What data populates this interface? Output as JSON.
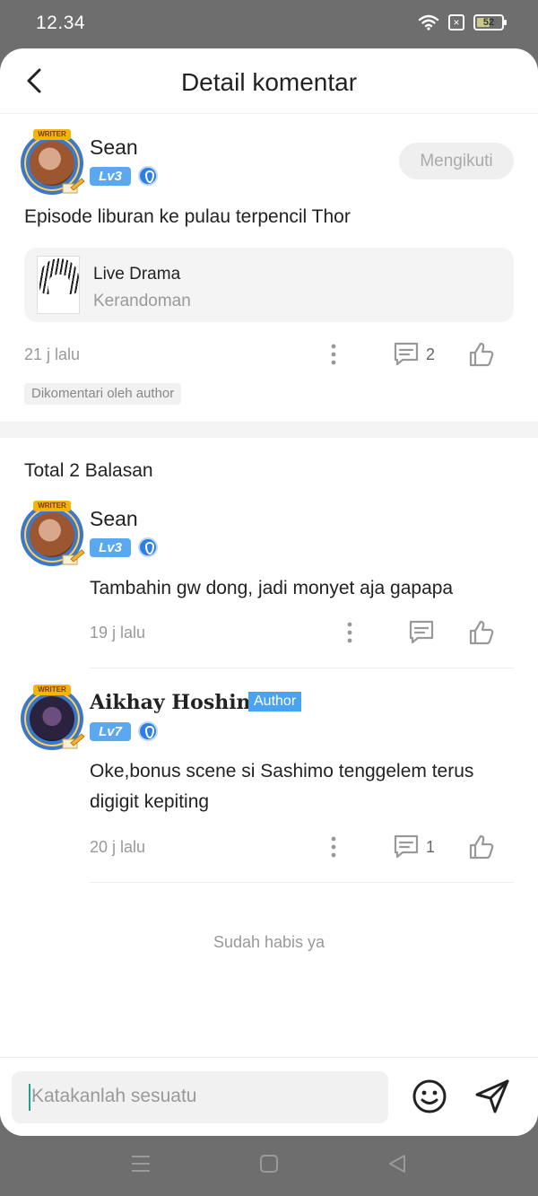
{
  "status_bar": {
    "time": "12.34",
    "battery": "52",
    "battery_level": 0.52
  },
  "header": {
    "title": "Detail komentar"
  },
  "post": {
    "user": "Sean",
    "level": "Lv3",
    "avatar_badge": "WRITER",
    "follow_label": "Mengikuti",
    "text": "Episode liburan ke pulau terpencil Thor",
    "book": {
      "title": "Live Drama",
      "subtitle": "Kerandoman"
    },
    "time": "21 j lalu",
    "reply_count": "2",
    "tag": "Dikomentari oleh author"
  },
  "replies_header": "Total 2 Balasan",
  "replies": [
    {
      "user": "Sean",
      "level": "Lv3",
      "avatar_badge": "WRITER",
      "text": "Tambahin gw dong, jadi monyet aja gapapa",
      "time": "19 j lalu",
      "reply_count": ""
    },
    {
      "user": "Aikhay Hoshino",
      "author_tag": "Author",
      "level": "Lv7",
      "avatar_badge": "WRITER",
      "text": "Oke,bonus scene si Sashimo tenggelem terus digigit kepiting",
      "time": "20 j lalu",
      "reply_count": "1"
    }
  ],
  "end_text": "Sudah habis ya",
  "composer": {
    "placeholder": "Katakanlah sesuatu"
  },
  "colors": {
    "level_badge": "#5aa8f0",
    "author_tag": "#4aa3f0",
    "caret": "#21a08a"
  },
  "icons": [
    "back-icon",
    "wifi-icon",
    "sim-icon",
    "battery-icon",
    "more-icon",
    "comment-icon",
    "like-icon",
    "emoji-icon",
    "send-icon",
    "menu-icon",
    "home-icon",
    "back-nav-icon"
  ]
}
